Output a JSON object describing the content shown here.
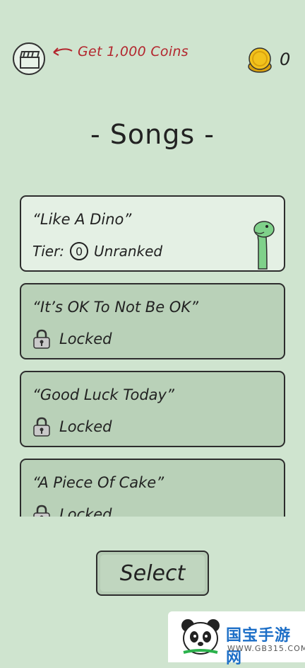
{
  "header": {
    "reward_text": "Get 1,000 Coins",
    "coin_count": "0",
    "icons": [
      "clapperboard-icon",
      "curved-arrow-icon",
      "coin-stack-icon"
    ]
  },
  "title": "- Songs -",
  "songs": [
    {
      "title": "“Like A Dino”",
      "tier_label": "Tier:",
      "tier_value": "0",
      "rank": "Unranked",
      "state": "unlocked",
      "icon": "dino-icon"
    },
    {
      "title": "“It’s OK To Not Be OK”",
      "status": "Locked",
      "state": "locked",
      "icon": "lock-icon"
    },
    {
      "title": "“Good Luck Today”",
      "status": "Locked",
      "state": "locked",
      "icon": "lock-icon"
    },
    {
      "title": "“A Piece Of Cake”",
      "status": "Locked",
      "state": "locked",
      "icon": "lock-icon"
    }
  ],
  "select_label": "Select",
  "watermark": {
    "name": "国宝手游网",
    "url": "WWW.GB315.COM"
  },
  "colors": {
    "background": "#cfe4cf",
    "card_unlocked": "#e4f0e4",
    "card_locked": "#b9d1b8",
    "reward_text": "#b3262e",
    "dino": "#7fd18a",
    "coin": "#f2c21c"
  }
}
